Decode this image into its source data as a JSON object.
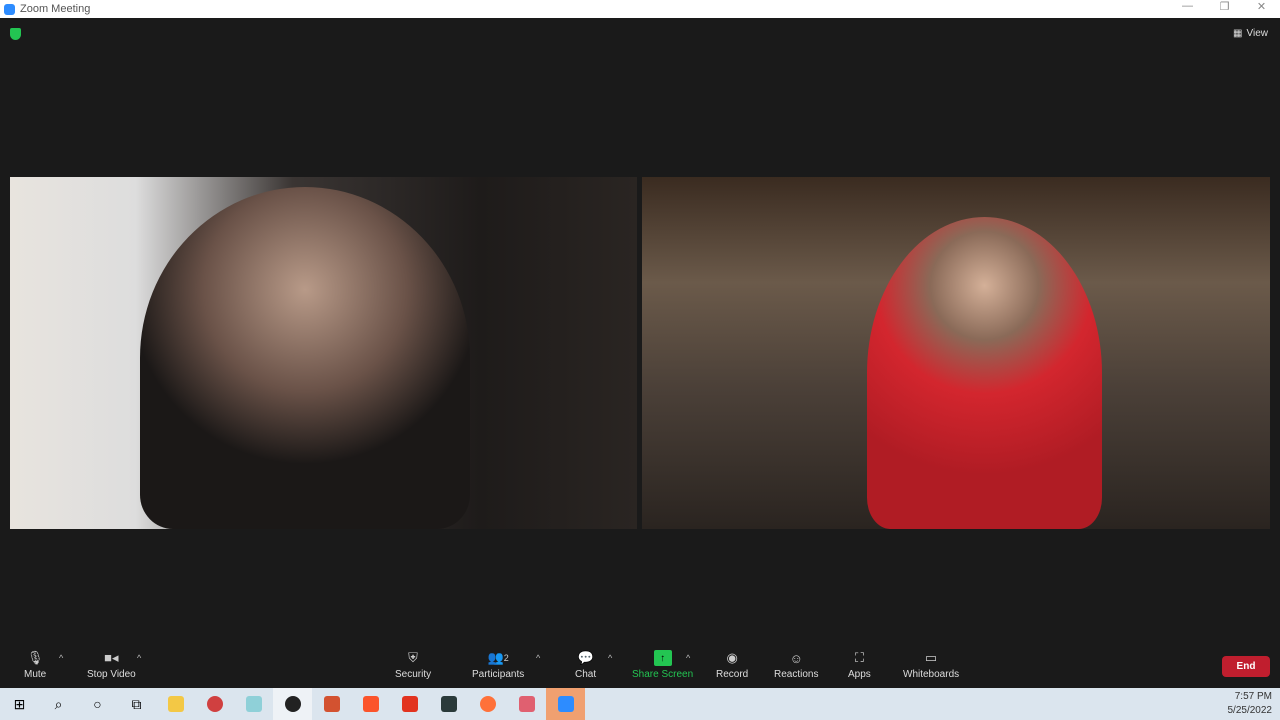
{
  "window": {
    "title": "Zoom Meeting"
  },
  "header": {
    "view_label": "View"
  },
  "toolbar": {
    "mute": "Mute",
    "stop_video": "Stop Video",
    "security": "Security",
    "participants": "Participants",
    "participant_count": "2",
    "chat": "Chat",
    "share_screen": "Share Screen",
    "record": "Record",
    "reactions": "Reactions",
    "apps": "Apps",
    "whiteboards": "Whiteboards",
    "end": "End"
  },
  "colors": {
    "share": "#23c552",
    "end": "#c01e2e"
  },
  "taskbar": {
    "time": "7:57 PM",
    "date": "5/25/2022"
  }
}
